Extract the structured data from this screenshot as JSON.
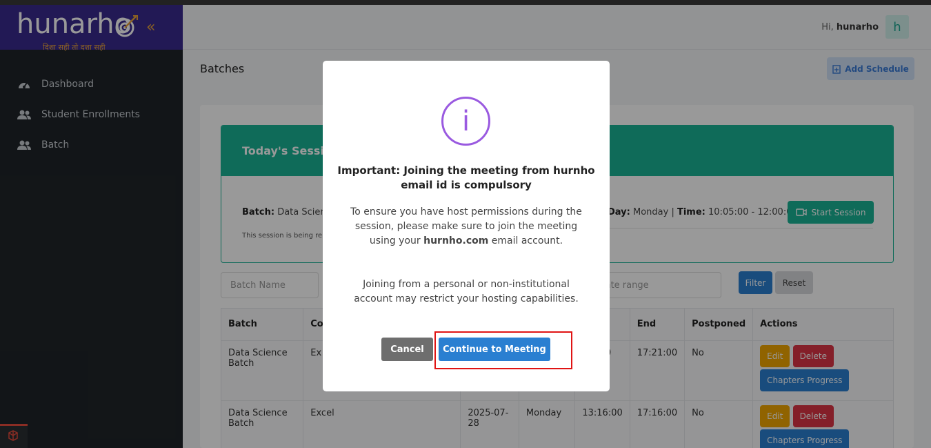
{
  "brand": {
    "name": "hunarho",
    "tagline": "दिशा सही तो दशा सही"
  },
  "sidebar": {
    "items": [
      {
        "label": "Dashboard",
        "icon": "dashboard-icon"
      },
      {
        "label": "Student Enrollments",
        "icon": "users-icon"
      },
      {
        "label": "Batch",
        "icon": "users-icon"
      }
    ]
  },
  "header": {
    "greeting_prefix": "Hi,",
    "username": "hunarho",
    "avatar_letter": "h"
  },
  "page": {
    "title": "Batches",
    "add_schedule_label": "Add Schedule"
  },
  "session": {
    "heading": "Today's Sessio",
    "batch_label": "Batch:",
    "batch_value": "Data Scienc",
    "day_label": "Day:",
    "day_value": "Monday",
    "separator": "|",
    "time_label": "Time:",
    "time_value": "10:05:00 - 12:00:00",
    "note": "This session is being re",
    "start_label": "Start Session"
  },
  "filters": {
    "batch_name_placeholder": "Batch Name",
    "date_range_placeholder": "late range",
    "filter_label": "Filter",
    "reset_label": "Reset"
  },
  "table": {
    "headers": [
      "Batch",
      "Co",
      "",
      "",
      "rt",
      "End",
      "Postponed",
      "Actions"
    ],
    "rows": [
      {
        "batch": "Data Science Batch",
        "course": "Ex",
        "date": "",
        "day": "",
        "start": ":00:00",
        "end": "17:21:00",
        "postponed": "No"
      },
      {
        "batch": "Data Science Batch",
        "course": "Excel",
        "date": "2025-07-28",
        "day": "Monday",
        "start": "13:16:00",
        "end": "17:16:00",
        "postponed": "No"
      }
    ],
    "actions": {
      "edit": "Edit",
      "delete": "Delete",
      "progress": "Chapters Progress"
    }
  },
  "modal": {
    "title": "Important: Joining the meeting from hurnho email id is compulsory",
    "p1_before": "To ensure you have host permissions during the session, please make sure to join the meeting using your",
    "p1_bold": "hurnho.com",
    "p1_after": "email account.",
    "p2": "Joining from a personal or non-institutional account may restrict your hosting capabilities.",
    "cancel_label": "Cancel",
    "continue_label": "Continue to Meeting",
    "icon_glyph": "i"
  },
  "colors": {
    "sidebar": "#1f2428",
    "logo_bg": "#3a2a8e",
    "teal": "#1ab394",
    "primary": "#2a7fd1",
    "info_purple": "#9a5ae0",
    "highlight": "#e01414"
  }
}
